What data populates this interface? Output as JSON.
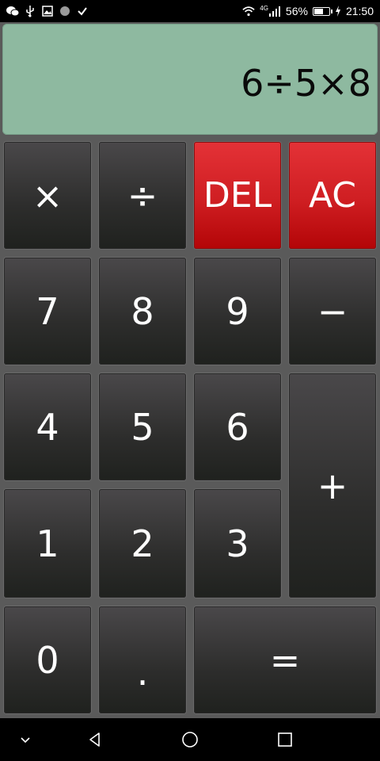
{
  "status_bar": {
    "battery": "56%",
    "time": "21:50",
    "network": "4G",
    "icons_left": [
      "wechat-icon",
      "usb-icon",
      "image-icon",
      "circle-icon",
      "check-icon"
    ],
    "icons_right": [
      "wifi-icon",
      "signal-icon",
      "battery-icon",
      "charging-icon"
    ]
  },
  "display": {
    "expression": "6÷5×8"
  },
  "keys": {
    "multiply": "×",
    "divide": "÷",
    "del": "DEL",
    "ac": "AC",
    "seven": "7",
    "eight": "8",
    "nine": "9",
    "minus": "−",
    "four": "4",
    "five": "5",
    "six": "6",
    "plus": "+",
    "one": "1",
    "two": "2",
    "three": "3",
    "zero": "0",
    "dot": ".",
    "equals": "="
  },
  "colors": {
    "display_bg": "#8eb9a0",
    "key_dark": "#2d2d2c",
    "key_red": "#cf1e22",
    "body_bg": "#5a5a5a"
  },
  "nav_bar": {
    "icons": [
      "chevron-down-icon",
      "back-icon",
      "home-icon",
      "recents-icon"
    ]
  }
}
